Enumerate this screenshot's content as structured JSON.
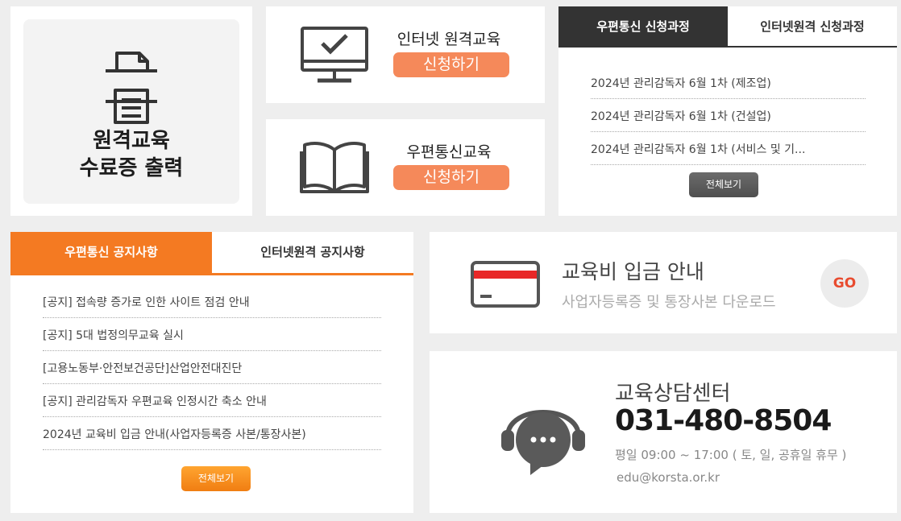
{
  "certificate": {
    "title_line1": "원격교육",
    "title_line2": "수료증 출력",
    "icon": "printer-icon"
  },
  "internet_course": {
    "name": "인터넷 원격교육",
    "apply_label": "신청하기",
    "icon": "monitor-check-icon"
  },
  "postal_course": {
    "name": "우편통신교육",
    "apply_label": "신청하기",
    "icon": "open-book-icon"
  },
  "course_tabs": {
    "tabs": [
      "우편통신 신청과정",
      "인터넷원격 신청과정"
    ],
    "active": 0,
    "items": [
      "2024년 관리감독자 6월 1차 (제조업)",
      "2024년 관리감독자 6월 1차 (건설업)",
      "2024년 관리감독자 6월 1차 (서비스 및 기..."
    ],
    "more_label": "전체보기"
  },
  "notice_tabs": {
    "tabs": [
      "우편통신 공지사항",
      "인터넷원격 공지사항"
    ],
    "active": 0,
    "items": [
      "[공지] 접속량 증가로 인한 사이트 점검 안내",
      "[공지] 5대 법정의무교육 실시",
      "[고용노동부·안전보건공단]산업안전대진단",
      "[공지] 관리감독자 우편교육 인정시간 축소 안내",
      "2024년 교육비 입금 안내(사업자등록증 사본/통장사본)"
    ],
    "more_label": "전체보기"
  },
  "payment": {
    "title": "교육비 입금 안내",
    "subtitle": "사업자등록증 및 통장사본 다운로드",
    "go_label": "GO",
    "icon": "credit-card-icon"
  },
  "contact": {
    "title": "교육상담센터",
    "phone": "031-480-8504",
    "hours": "평일 09:00 ~ 17:00 ( 토, 일, 공휴일 휴무 )",
    "email": "edu@korsta.or.kr",
    "icon": "headset-chat-icon"
  },
  "colors": {
    "orange": "#f47a22",
    "apply_orange": "#f5895a",
    "dark_tab": "#333333",
    "go_red": "#e84b2f"
  }
}
